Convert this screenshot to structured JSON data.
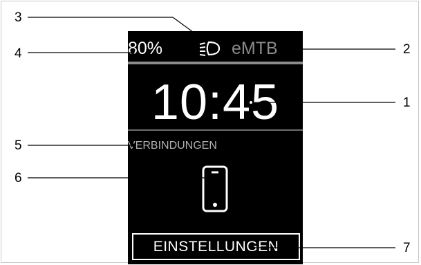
{
  "display": {
    "battery": "80%",
    "mode": "eMTB",
    "time": "10:45",
    "connections_label": "VERBINDUNGEN",
    "settings_button": "EINSTELLUNGEN",
    "icons": [
      "headlight-icon",
      "smartphone-icon"
    ]
  },
  "callouts": {
    "n1": "1",
    "n2": "2",
    "n3": "3",
    "n4": "4",
    "n5": "5",
    "n6": "6",
    "n7": "7"
  },
  "colors": {
    "screen_background": "#000000",
    "primary_text": "#ffffff",
    "dim_text": "#8a8a8a",
    "divider": "#8c8c8c"
  }
}
